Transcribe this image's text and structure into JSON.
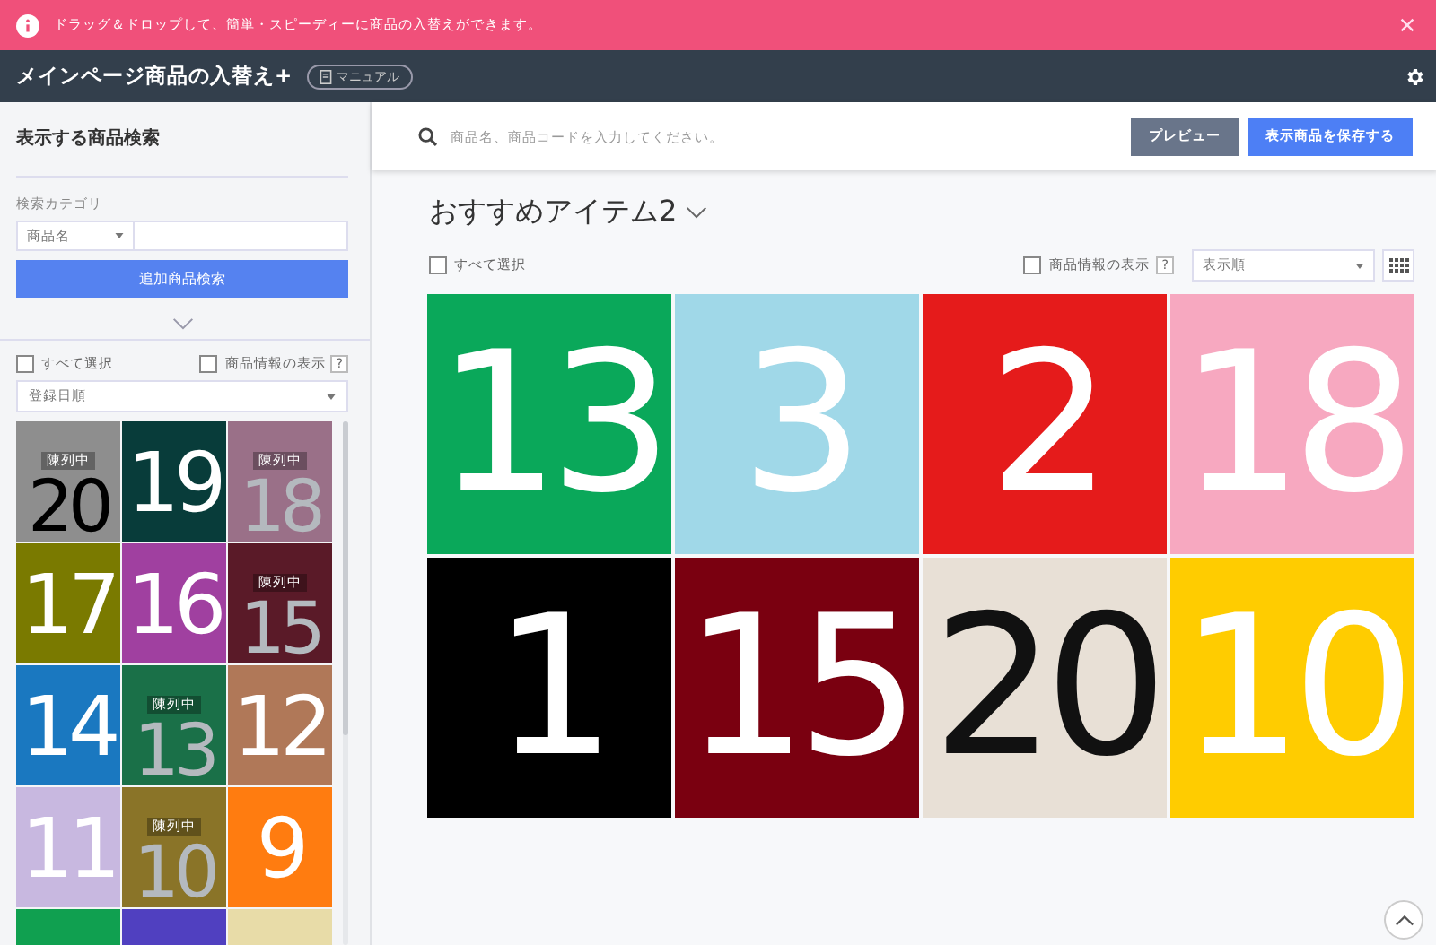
{
  "notice": {
    "text": "ドラッグ＆ドロップして、簡単・スピーディーに商品の入替えができます。"
  },
  "header": {
    "title": "メインページ商品の入替え+",
    "manual": "マニュアル"
  },
  "sidebar": {
    "title": "表示する商品検索",
    "category_label": "検索カテゴリ",
    "category_select": "商品名",
    "search_button": "追加商品検索",
    "select_all": {
      "label": "すべて選択",
      "checked": false
    },
    "show_info": {
      "label": "商品情報の表示",
      "checked": false,
      "help": "?"
    },
    "sort": "登録日順",
    "tiles": [
      {
        "number": "20",
        "color": "#8e8e8e",
        "dark_number": true,
        "displayed": true,
        "badge": "陳列中"
      },
      {
        "number": "19",
        "color": "#083c3a",
        "dark_number": false,
        "displayed": false
      },
      {
        "number": "18",
        "color": "#9a7088",
        "dark_number": false,
        "displayed": true,
        "badge": "陳列中"
      },
      {
        "number": "17",
        "color": "#7a7a00",
        "dark_number": false,
        "displayed": false
      },
      {
        "number": "16",
        "color": "#a040a0",
        "dark_number": false,
        "displayed": false
      },
      {
        "number": "15",
        "color": "#5a1a28",
        "dark_number": false,
        "displayed": true,
        "badge": "陳列中"
      },
      {
        "number": "14",
        "color": "#1a78c0",
        "dark_number": false,
        "displayed": false
      },
      {
        "number": "13",
        "color": "#1a7048",
        "dark_number": false,
        "displayed": true,
        "badge": "陳列中"
      },
      {
        "number": "12",
        "color": "#b07858",
        "dark_number": false,
        "displayed": false
      },
      {
        "number": "11",
        "color": "#c8b8e0",
        "dark_number": false,
        "displayed": false
      },
      {
        "number": "10",
        "color": "#8a7428",
        "dark_number": false,
        "displayed": true,
        "badge": "陳列中"
      },
      {
        "number": "9",
        "color": "#ff7c10",
        "dark_number": false,
        "displayed": false
      },
      {
        "color": "#10a050"
      },
      {
        "color": "#5040c0"
      },
      {
        "color": "#e8dca8"
      }
    ]
  },
  "toolbar": {
    "search_placeholder": "商品名、商品コードを入力してください。",
    "preview": "プレビュー",
    "save": "表示商品を保存する"
  },
  "main": {
    "heading": "おすすめアイテム2",
    "select_all": {
      "label": "すべて選択",
      "checked": false
    },
    "show_info": {
      "label": "商品情報の表示",
      "checked": false,
      "help": "?"
    },
    "sort": "表示順",
    "tiles": [
      {
        "number": "13",
        "color": "#0aa85a",
        "dark_number": false
      },
      {
        "number": "3",
        "color": "#a0d8e8",
        "dark_number": false
      },
      {
        "number": "2",
        "color": "#e51b1b",
        "dark_number": false
      },
      {
        "number": "18",
        "color": "#f7a8c0",
        "dark_number": false
      },
      {
        "number": "1",
        "color": "#000000",
        "dark_number": false
      },
      {
        "number": "15",
        "color": "#7a0010",
        "dark_number": false
      },
      {
        "number": "20",
        "color": "#e8e0d6",
        "dark_number": true
      },
      {
        "number": "10",
        "color": "#ffcc00",
        "dark_number": false
      }
    ]
  }
}
